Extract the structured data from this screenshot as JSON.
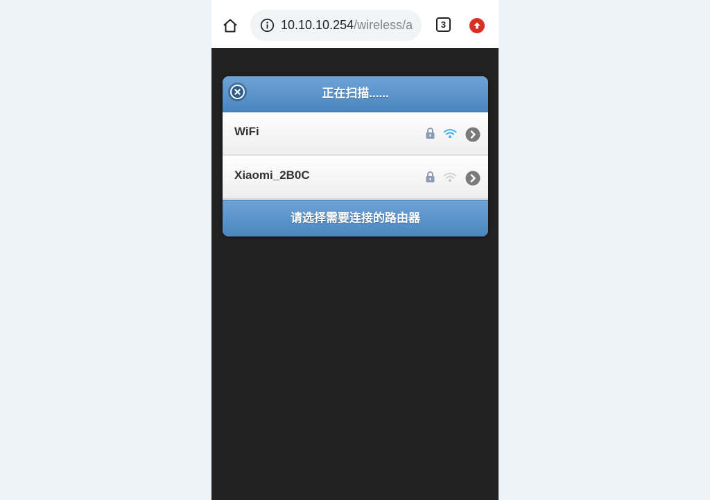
{
  "browser": {
    "url_host": "10.10.10.254",
    "url_path": "/wireless/a",
    "tab_count": "3",
    "icons": {
      "home": "home-icon",
      "info": "info-icon",
      "tabs": "tab-switcher-icon",
      "update": "update-icon"
    },
    "colors": {
      "toolbar": "#ffffff",
      "url_field": "#f1f3f4",
      "update_badge": "#d93025"
    }
  },
  "dialog": {
    "title": "正在扫描......",
    "footer": "请选择需要连接的路由器",
    "close_icon": "close-icon",
    "colors": {
      "header": "#4a86c0",
      "page_background": "#222222"
    },
    "networks": [
      {
        "ssid": "WiFi",
        "secured": true,
        "signal": "strong",
        "icons": [
          "lock-icon",
          "wifi-signal-icon",
          "chevron-right-icon"
        ]
      },
      {
        "ssid": "Xiaomi_2B0C",
        "secured": true,
        "signal": "weak",
        "icons": [
          "lock-icon",
          "wifi-signal-icon",
          "chevron-right-icon"
        ]
      }
    ]
  }
}
